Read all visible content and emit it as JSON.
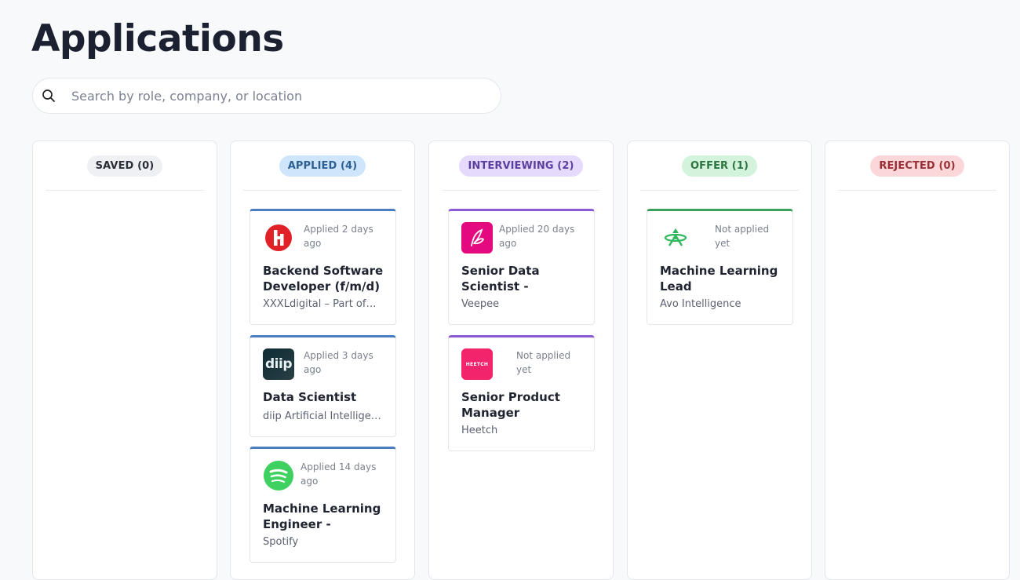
{
  "page": {
    "title": "Applications"
  },
  "search": {
    "placeholder": "Search by role, company, or location",
    "value": ""
  },
  "columns": [
    {
      "label": "SAVED (0)",
      "color_bg": "#eef0f3",
      "color_fg": "#2b2f38"
    },
    {
      "label": "APPLIED (4)",
      "color_bg": "#cfe5fb",
      "color_fg": "#2e5f93",
      "accent": "#4b7ec0"
    },
    {
      "label": "INTERVIEWING (2)",
      "color_bg": "#e6dafc",
      "color_fg": "#5b3f9e",
      "accent": "#8b5cd6"
    },
    {
      "label": "OFFER (1)",
      "color_bg": "#d3f3dc",
      "color_fg": "#2d7440",
      "accent": "#3aa05c"
    },
    {
      "label": "REJECTED (0)",
      "color_bg": "#fbd7d9",
      "color_fg": "#9a2f36"
    }
  ],
  "cards": {
    "applied": [
      {
        "status": "Applied 2 days ago",
        "title": "Backend Software Developer (f/m/d)",
        "company": "XXXLdigital – Part of…",
        "logo": "xxxl-logo"
      },
      {
        "status": "Applied 3 days ago",
        "title": "Data Scientist",
        "company": "diip Artificial Intelligence",
        "logo": "diip-logo",
        "logo_text": "diip"
      },
      {
        "status": "Applied 14 days ago",
        "title": "Machine Learning Engineer - Content…",
        "company": "Spotify",
        "logo": "spotify-logo"
      }
    ],
    "interviewing": [
      {
        "status": "Applied 20 days ago",
        "title": "Senior Data Scientist - Permanent",
        "company": "Veepee",
        "logo": "veepee-logo"
      },
      {
        "status": "Not applied yet",
        "title": "Senior Product Manager",
        "company": "Heetch",
        "logo": "heetch-logo",
        "logo_text": "HEETCH"
      }
    ],
    "offer": [
      {
        "status": "Not applied yet",
        "title": "Machine Learning Lead",
        "company": "Avo Intelligence",
        "logo": "avo-logo"
      }
    ]
  }
}
